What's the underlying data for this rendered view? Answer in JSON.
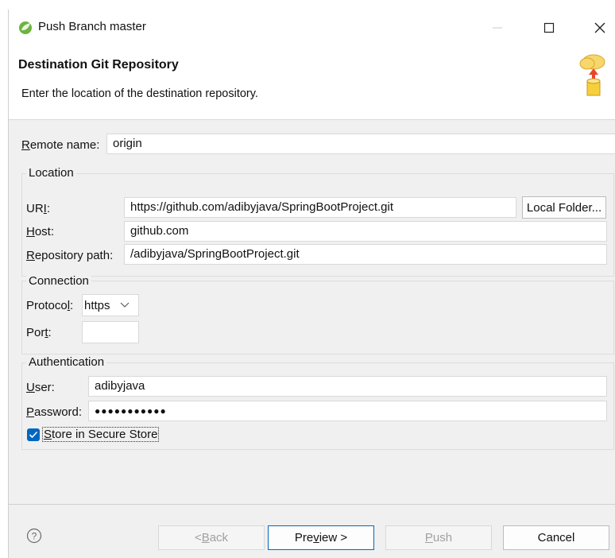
{
  "window": {
    "title": "Push Branch master"
  },
  "header": {
    "title": "Destination Git Repository",
    "description": "Enter the location of the destination repository."
  },
  "remote": {
    "label_mnemonic": "R",
    "label_rest": "emote name:",
    "value": "origin"
  },
  "location": {
    "group_title": "Location",
    "uri_label_a": "UR",
    "uri_label_mnemonic": "I",
    "uri_label_b": ":",
    "uri_value": "https://github.com/adibyjava/SpringBootProject.git",
    "local_folder_label": "Local Folder...",
    "host_label_mnemonic": "H",
    "host_label_rest": "ost:",
    "host_value": "github.com",
    "repo_label_mnemonic": "R",
    "repo_label_rest": "epository path:",
    "repo_value": "/adibyjava/SpringBootProject.git"
  },
  "connection": {
    "group_title": "Connection",
    "protocol_label_a": "Protoco",
    "protocol_label_mnemonic": "l",
    "protocol_label_b": ":",
    "protocol_value": "https",
    "port_label_a": "Por",
    "port_label_mnemonic": "t",
    "port_label_b": ":",
    "port_value": ""
  },
  "authentication": {
    "group_title": "Authentication",
    "user_label_mnemonic": "U",
    "user_label_rest": "ser:",
    "user_value": "adibyjava",
    "password_label_mnemonic": "P",
    "password_label_rest": "assword:",
    "password_value": "●●●●●●●●●●●",
    "store_label_mnemonic": "S",
    "store_label_rest": "tore in Secure Store",
    "store_checked": true
  },
  "buttons": {
    "back_a": "< ",
    "back_mnemonic": "B",
    "back_b": "ack",
    "preview_a": "Pre",
    "preview_mnemonic": "v",
    "preview_b": "iew >",
    "push_mnemonic": "P",
    "push_rest": "ush",
    "cancel": "Cancel"
  },
  "colors": {
    "accent": "#0067c0",
    "dialog_bg": "#f0f0f0"
  }
}
